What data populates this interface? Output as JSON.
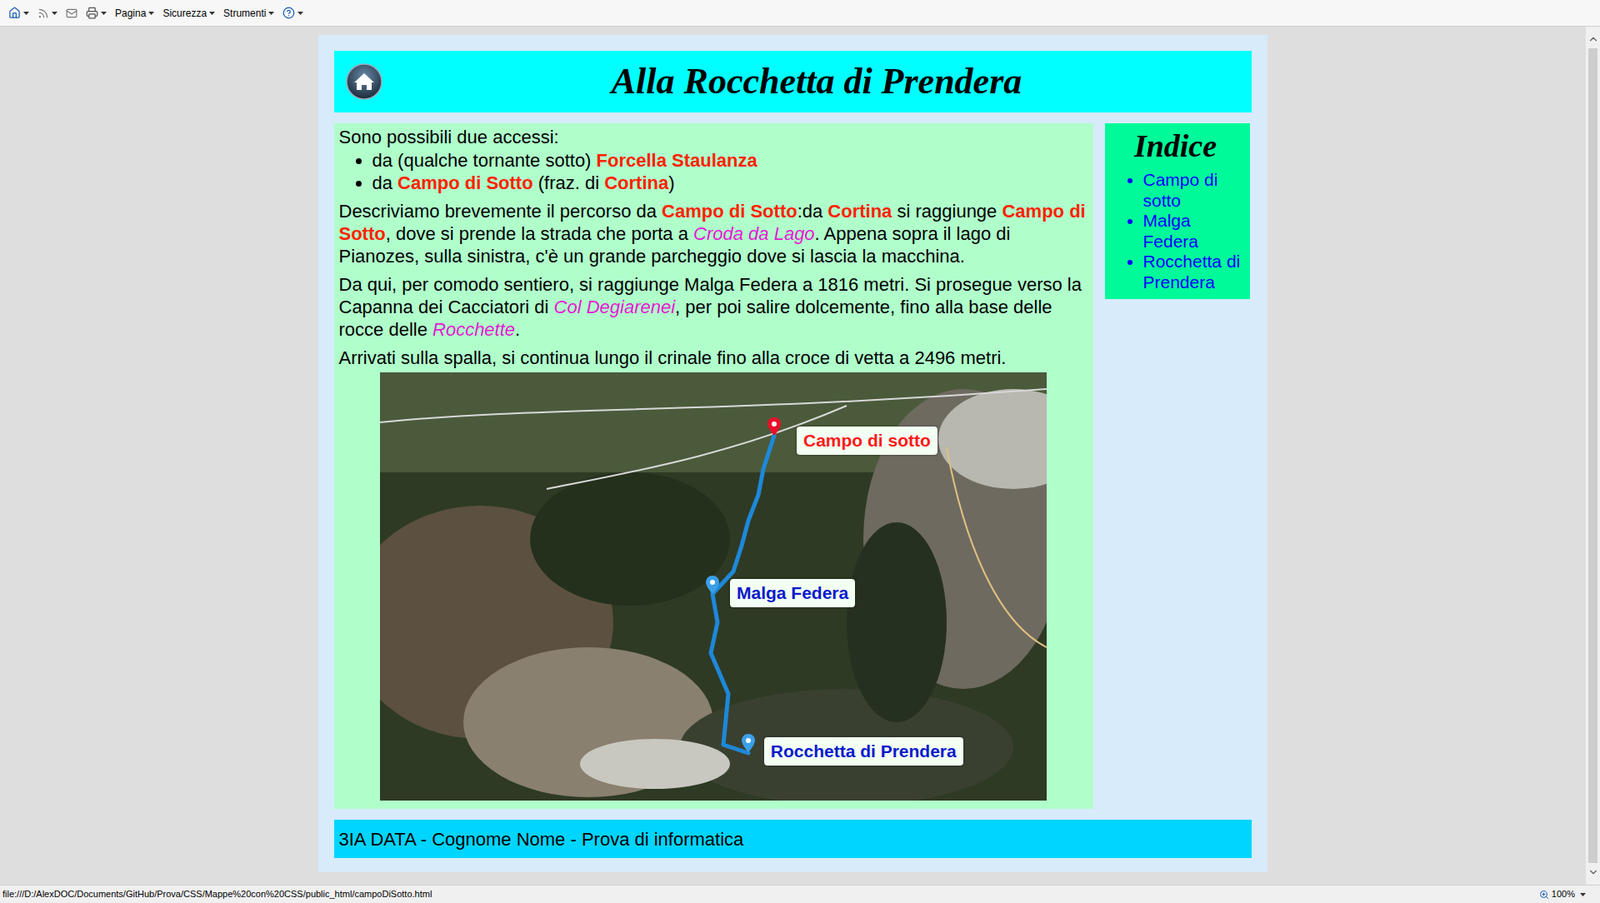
{
  "browser": {
    "command_bar": {
      "menus": [
        "Pagina",
        "Sicurezza",
        "Strumenti"
      ]
    },
    "status_bar": {
      "url": "file:///D:/AlexDOC/Documents/GitHub/Prova/CSS/Mappe%20con%20CSS/public_html/campoDiSotto.html",
      "zoom": "100%"
    }
  },
  "page": {
    "header": {
      "title": "Alla Rocchetta di Prendera"
    },
    "content": {
      "intro": [
        {
          "text": "Sono possibili due accessi:",
          "kind": "plain"
        }
      ],
      "accesses": [
        [
          {
            "text": "da (qualche tornante sotto) ",
            "kind": "plain"
          },
          {
            "text": "Forcella Staulanza",
            "kind": "place"
          }
        ],
        [
          {
            "text": "da ",
            "kind": "plain"
          },
          {
            "text": "Campo di Sotto",
            "kind": "place"
          },
          {
            "text": " (fraz. di ",
            "kind": "plain"
          },
          {
            "text": "Cortina",
            "kind": "place"
          },
          {
            "text": ")",
            "kind": "plain"
          }
        ]
      ],
      "paragraphs": [
        [
          {
            "text": "Descriviamo brevemente il percorso da ",
            "kind": "plain"
          },
          {
            "text": "Campo di Sotto",
            "kind": "place"
          },
          {
            "text": ":da ",
            "kind": "plain"
          },
          {
            "text": "Cortina",
            "kind": "place"
          },
          {
            "text": " si raggiunge ",
            "kind": "plain"
          },
          {
            "text": "Campo di Sotto",
            "kind": "place"
          },
          {
            "text": ", dove si prende la strada che porta a ",
            "kind": "plain"
          },
          {
            "text": "Croda da Lago",
            "kind": "landmark"
          },
          {
            "text": ". Appena sopra il lago di Pianozes, sulla sinistra, c'è un grande parcheggio dove si lascia la macchina.",
            "kind": "plain"
          }
        ],
        [
          {
            "text": "Da qui, per comodo sentiero, si raggiunge Malga Federa a 1816 metri. Si prosegue verso la Capanna dei Cacciatori di ",
            "kind": "plain"
          },
          {
            "text": "Col Degiarenei",
            "kind": "landmark"
          },
          {
            "text": ", per poi salire dolcemente, fino alla base delle rocce delle ",
            "kind": "plain"
          },
          {
            "text": "Rocchette",
            "kind": "landmark"
          },
          {
            "text": ".",
            "kind": "plain"
          }
        ],
        [
          {
            "text": "Arrivati sulla spalla, si continua lungo il crinale fino alla croce di vetta a 2496 metri.",
            "kind": "plain"
          }
        ]
      ]
    },
    "map": {
      "pins": [
        {
          "label": "Campo di sotto",
          "color": "#ff1a1a"
        },
        {
          "label": "Malga Federa",
          "color": "#0a1acc"
        },
        {
          "label": "Rocchetta di Prendera",
          "color": "#0a1acc"
        }
      ]
    },
    "index": {
      "title": "Indice",
      "links": [
        "Campo di sotto",
        "Malga Federa",
        "Rocchetta di Prendera"
      ]
    },
    "footer": "3IA DATA - Cognome Nome - Prova di informatica"
  }
}
